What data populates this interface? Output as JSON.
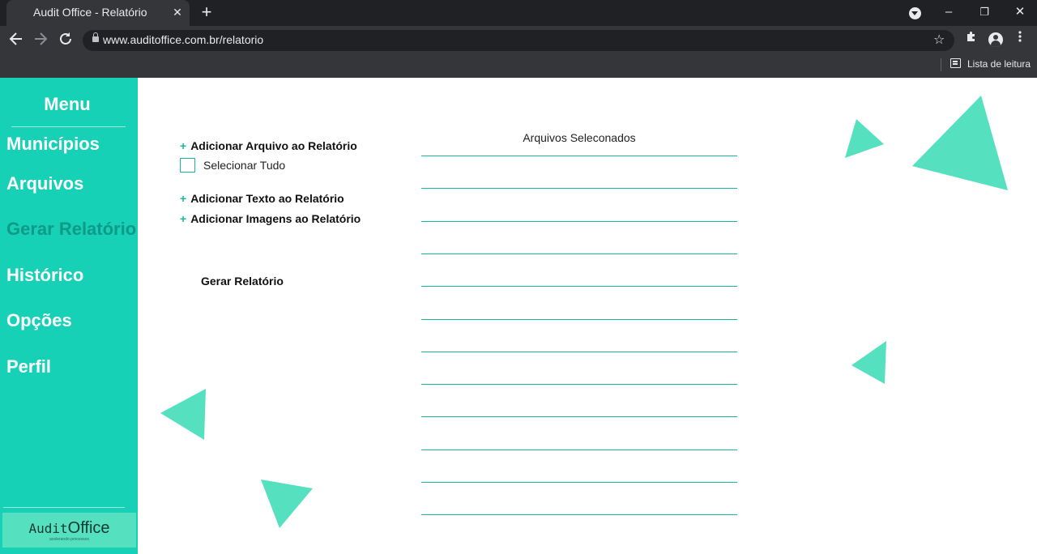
{
  "browser": {
    "tab_title": "Audit Office - Relatório",
    "tab_close": "✕",
    "new_tab": "+",
    "url": "www.auditoffice.com.br/relatorio",
    "reading_list": "Lista de leitura",
    "window_controls": {
      "minimize": "–",
      "restore": "❐",
      "close": "✕"
    }
  },
  "sidebar": {
    "title": "Menu",
    "items": [
      {
        "label": "Municípios",
        "active": false
      },
      {
        "label": "Arquivos",
        "active": false
      },
      {
        "label": "Gerar Relatório",
        "active": true
      },
      {
        "label": "Histórico",
        "active": false
      },
      {
        "label": "Opções",
        "active": false
      },
      {
        "label": "Perfil",
        "active": false
      }
    ],
    "logo": {
      "audit": "Audit",
      "office": "Office",
      "tagline": "acelerando processos"
    }
  },
  "main": {
    "add_file": "Adicionar Arquivo ao Relatório",
    "select_all": "Selecionar Tudo",
    "add_text": "Adicionar Texto ao Relatório",
    "add_images": "Adicionar Imagens ao Relatório",
    "generate": "Gerar Relatório",
    "files_title": "Arquivos Seleconados",
    "files": [
      "",
      "",
      "",
      "",
      "",
      "",
      "",
      "",
      "",
      "",
      "",
      ""
    ]
  },
  "colors": {
    "sidebar_bg": "#17d1b7",
    "active_item": "#0e9a87",
    "accent": "#17b9a0",
    "decoration": "#55e0c0"
  },
  "icons": {
    "back": "arrow-left-icon",
    "forward": "arrow-right-icon",
    "reload": "reload-icon",
    "lock": "lock-icon",
    "bookmark": "star-icon",
    "extensions": "puzzle-icon",
    "profile": "person-icon",
    "menu": "kebab-menu-icon",
    "reading_list": "reading-list-icon",
    "add": "plus-icon"
  }
}
